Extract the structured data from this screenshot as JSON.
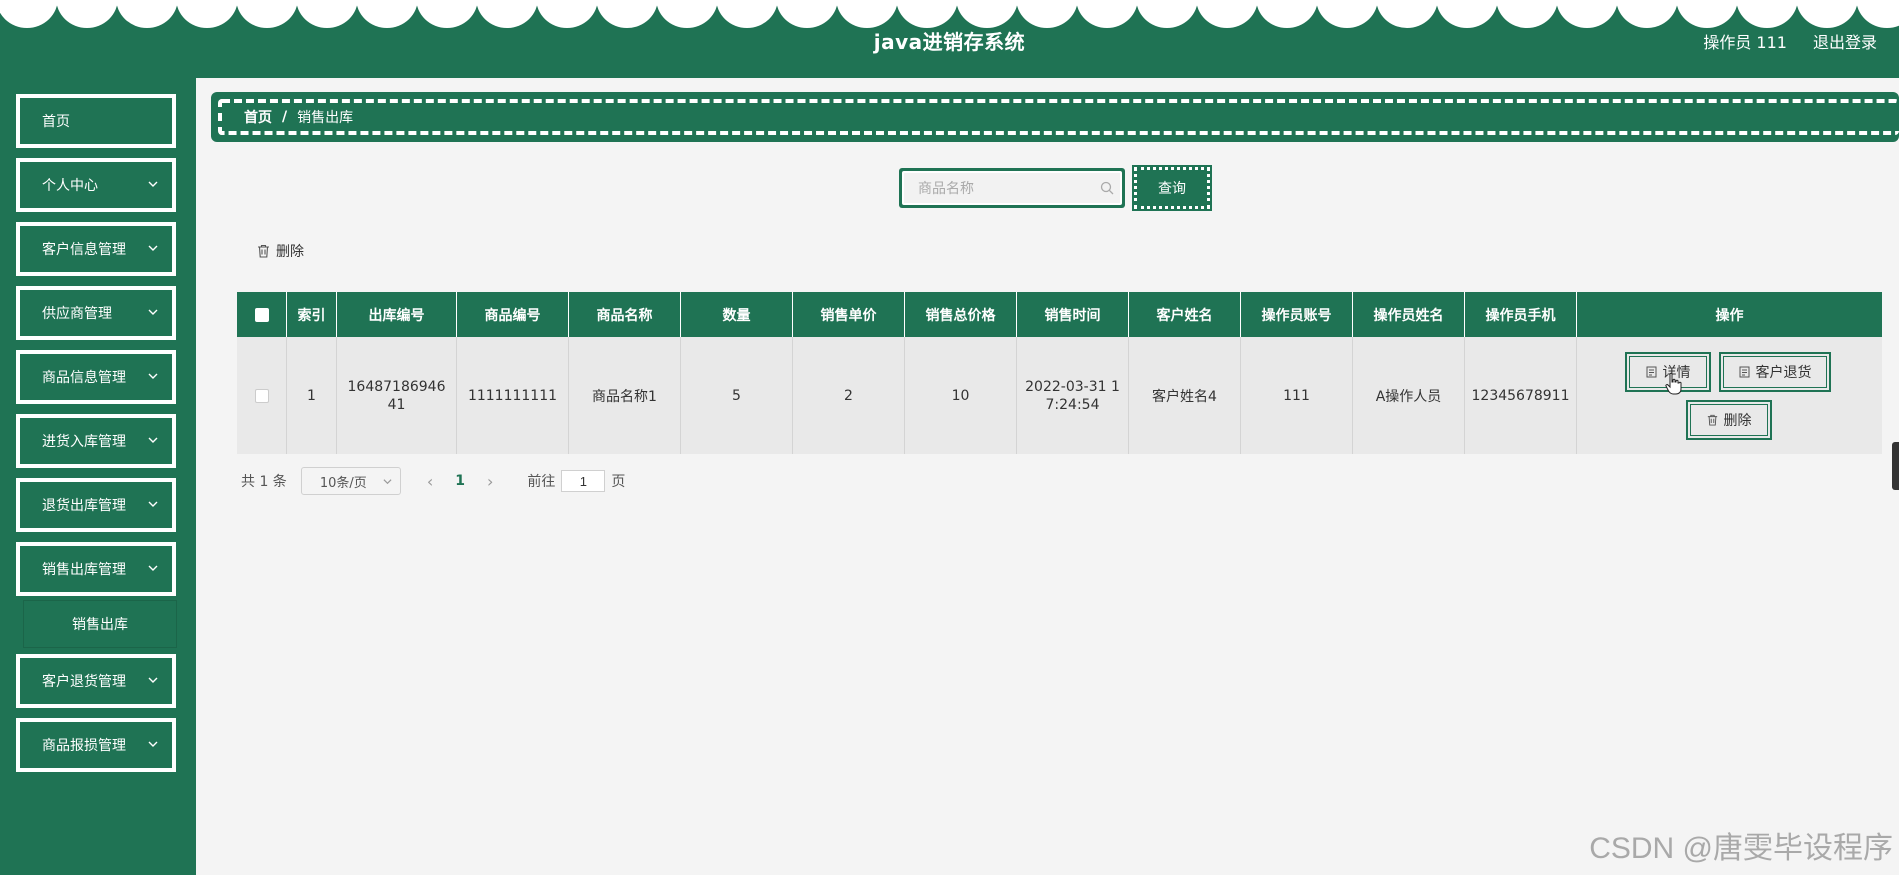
{
  "header": {
    "title": "java进销存系统",
    "operator_label": "操作员 111",
    "logout_label": "退出登录"
  },
  "sidebar": {
    "items": [
      {
        "label": "首页",
        "has_chevron": false
      },
      {
        "label": "个人中心",
        "has_chevron": true
      },
      {
        "label": "客户信息管理",
        "has_chevron": true
      },
      {
        "label": "供应商管理",
        "has_chevron": true
      },
      {
        "label": "商品信息管理",
        "has_chevron": true
      },
      {
        "label": "进货入库管理",
        "has_chevron": true
      },
      {
        "label": "退货出库管理",
        "has_chevron": true
      },
      {
        "label": "销售出库管理",
        "has_chevron": true
      },
      {
        "label": "客户退货管理",
        "has_chevron": true
      },
      {
        "label": "商品报损管理",
        "has_chevron": true
      }
    ],
    "submenu": {
      "label": "销售出库"
    }
  },
  "breadcrumb": {
    "home": "首页",
    "separator": "/",
    "current": "销售出库"
  },
  "search": {
    "placeholder": "商品名称",
    "value": "",
    "button_label": "查询"
  },
  "toolbar": {
    "delete_label": "删除"
  },
  "table": {
    "columns": [
      "索引",
      "出库编号",
      "商品编号",
      "商品名称",
      "数量",
      "销售单价",
      "销售总价格",
      "销售时间",
      "客户姓名",
      "操作员账号",
      "操作员姓名",
      "操作员手机",
      "操作"
    ],
    "rows": [
      {
        "index": "1",
        "outbound_no_line1": "16487186946",
        "outbound_no_line2": "41",
        "product_no": "1111111111",
        "product_name": "商品名称1",
        "quantity": "5",
        "unit_price": "2",
        "total_price": "10",
        "sale_time_line1": "2022-03-31 1",
        "sale_time_line2": "7:24:54",
        "customer_name": "客户姓名4",
        "operator_account": "111",
        "operator_name": "A操作人员",
        "operator_phone": "12345678911",
        "actions": {
          "detail": "详情",
          "return": "客户退货",
          "delete": "删除"
        }
      }
    ]
  },
  "pagination": {
    "total_label": "共 1 条",
    "page_size_label": "10条/页",
    "current_page": "1",
    "goto_label": "前往",
    "goto_value": "1",
    "page_suffix": "页"
  },
  "watermark": "CSDN @唐雯毕设程序",
  "colors": {
    "primary": "#1f7354",
    "background": "#f4f4f4",
    "row": "#e9e9e9"
  }
}
